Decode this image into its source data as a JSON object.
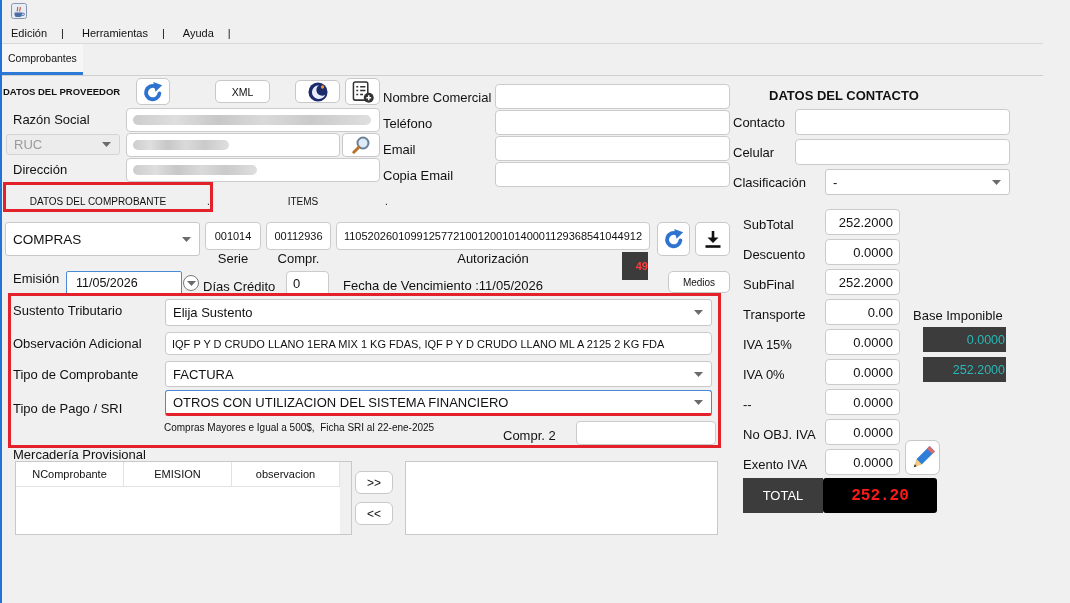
{
  "menu": [
    {
      "label": "Edición",
      "separator": "|"
    },
    {
      "label": "Herramientas",
      "separator": "|"
    },
    {
      "label": "Ayuda",
      "separator": "|"
    }
  ],
  "tabs": [
    {
      "label": "Comprobantes",
      "selected": true
    }
  ],
  "provider": {
    "title": "DATOS DEL PROVEEDOR",
    "buttons": [
      {
        "kind": "refresh"
      },
      {
        "kind": "text",
        "label": "XML"
      },
      {
        "kind": "crescent"
      },
      {
        "kind": "list"
      }
    ],
    "razon_social": {
      "label": "Razón Social",
      "blurred": true
    },
    "id_type": {
      "value": "RUC",
      "disabled": true
    },
    "ruc": {
      "blurred": true
    },
    "direccion": {
      "label": "Dirección",
      "blurred": true
    }
  },
  "commercial": [
    {
      "label": "Nombre Comercial"
    },
    {
      "label": "Teléfono"
    },
    {
      "label": "Email"
    },
    {
      "label": "Copia Email"
    }
  ],
  "contact": {
    "title": "DATOS DEL CONTACTO",
    "fields": [
      {
        "label": "Contacto",
        "kind": "text"
      },
      {
        "label": "Celular",
        "kind": "text"
      },
      {
        "label": "Clasificación",
        "kind": "select",
        "value": "-"
      }
    ]
  },
  "subtabs": [
    {
      "label": "DATOS DEL COMPROBANTE",
      "dot": ".",
      "highlighted": true
    },
    {
      "label": "ITEMS",
      "dot": ".",
      "highlighted": false
    }
  ],
  "comprobante": {
    "type": {
      "value": "COMPRAS"
    },
    "serie": {
      "label": "Serie",
      "value": "001014"
    },
    "numero": {
      "label": "Compr.",
      "value": "00112936"
    },
    "autorizacion": {
      "label": "Autorización",
      "value": "1105202601099125772100120010140001129368541044912"
    },
    "counter": "49",
    "emision": {
      "label": "Emisión",
      "value": "11/05/2026",
      "focused": true
    },
    "dias_credito": {
      "label": "Días Crédito",
      "value": "0"
    },
    "vencimiento": "Fecha de Vencimiento :11/05/2026",
    "medios_button": "Medios",
    "details": {
      "highlighted": true,
      "rows": [
        {
          "label": "Sustento Tributario",
          "kind": "select",
          "value": "Elija Sustento",
          "focused": false,
          "highlighted": false
        },
        {
          "label": "Observación Adicional",
          "kind": "text",
          "value": "IQF P Y D CRUDO LLANO 1ERA MIX 1 KG FDAS, IQF P Y D CRUDO LLANO ML A 2125 2 KG FDA",
          "focused": false,
          "highlighted": false
        },
        {
          "label": "Tipo de Comprobante",
          "kind": "select",
          "value": "FACTURA",
          "focused": false,
          "highlighted": false
        },
        {
          "label": "Tipo de Pago / SRI",
          "kind": "select",
          "value": "OTROS CON UTILIZACION DEL SISTEMA FINANCIERO",
          "focused": true,
          "highlighted": true
        }
      ],
      "note": "Compras Mayores e Igual a 500$,  Ficha SRI al 22-ene-2025",
      "compr2": {
        "label": "Compr. 2"
      }
    },
    "provisional": {
      "title": "Mercadería Provisional",
      "columns": [
        "NComprobante",
        "EMISION",
        "observacion"
      ],
      "move_buttons": [
        ">>",
        "<<"
      ]
    }
  },
  "totals": {
    "rows": [
      {
        "label": "SubTotal",
        "value": "252.2000"
      },
      {
        "label": "Descuento",
        "value": "0.0000"
      },
      {
        "label": "SubFinal",
        "value": "252.2000"
      },
      {
        "label": "Transporte",
        "value": "0.00"
      },
      {
        "label": "IVA 15%",
        "value": "0.0000"
      },
      {
        "label": "IVA 0%",
        "value": "0.0000"
      },
      {
        "label": "--",
        "value": "0.0000"
      },
      {
        "label": "No OBJ. IVA",
        "value": "0.0000"
      },
      {
        "label": "Exento IVA",
        "value": "0.0000"
      }
    ],
    "base_imponible": {
      "label": "Base Imponible",
      "values": [
        "0.0000",
        "252.2000"
      ]
    },
    "total": {
      "label": "TOTAL",
      "value": "252.20"
    }
  }
}
